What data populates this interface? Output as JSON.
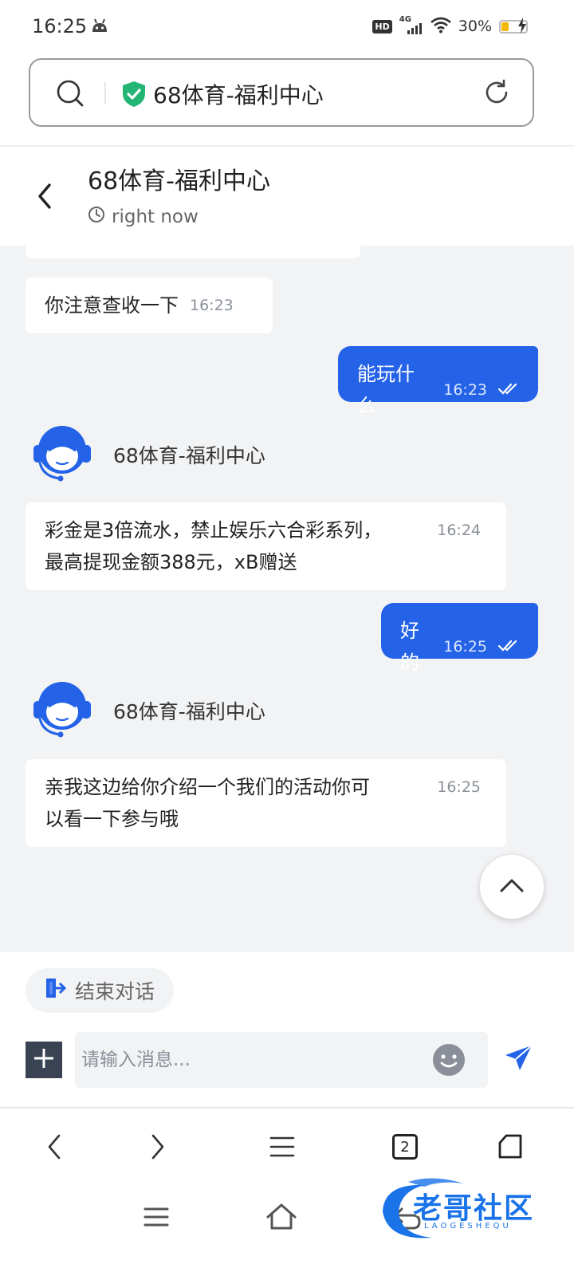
{
  "status_bar": {
    "time": "16:25",
    "hd": "HD",
    "network": "4G",
    "battery_percent_text": "30%",
    "battery_level": 0.3
  },
  "browser": {
    "url_text": "68体育-福利中心",
    "tab_count": "2"
  },
  "chat": {
    "title": "68体育-福利中心",
    "subtitle": "right now",
    "agent_name": "68体育-福利中心",
    "messages": [
      {
        "text": "你注意查收一下",
        "time": "16:23",
        "direction": "in"
      },
      {
        "text": "能玩什么",
        "time": "16:23",
        "direction": "out"
      },
      {
        "text": "彩金是3倍流水，禁止娱乐六合彩系列，最高提现金额388元，xB赠送",
        "line1": "彩金是3倍流水，禁止娱乐六合彩系列，",
        "line2": "最高提现金额388元，xB赠送",
        "time": "16:24",
        "direction": "in"
      },
      {
        "text": "好的",
        "time": "16:25",
        "direction": "out"
      },
      {
        "text": "亲我这边给你介绍一个我们的活动你可以看一下参与哦",
        "line1": "亲我这边给你介绍一个我们的活动你可",
        "line2": "以看一下参与哦",
        "time": "16:25",
        "direction": "in"
      }
    ]
  },
  "composer": {
    "end_chat_label": "结束对话",
    "placeholder": "请输入消息..."
  },
  "watermark": {
    "text": "老哥社区",
    "sub": "LAOGESHEQU"
  },
  "colors": {
    "accent": "#2463e8",
    "chat_bg": "#f2f3f5",
    "shield": "#22b573",
    "battery": "#f5b800"
  }
}
